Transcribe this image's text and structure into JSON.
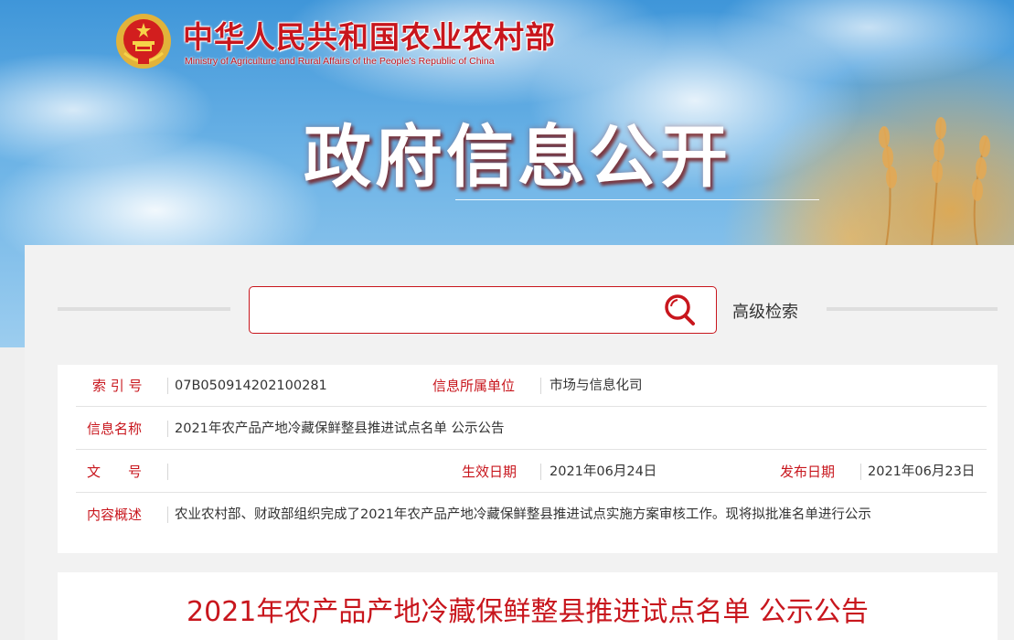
{
  "header": {
    "site_name_cn": "中华人民共和国农业农村部",
    "site_name_en": "Ministry of Agriculture and Rural Affairs of the People's Republic of China",
    "hero_title": "政府信息公开",
    "brand_color": "#c8161d"
  },
  "search": {
    "value": "",
    "placeholder": "",
    "search_icon": "search-icon",
    "advanced_label": "高级检索"
  },
  "info": {
    "index_label": "索 引 号",
    "index_value": "07B050914202100281",
    "unit_label": "信息所属单位",
    "unit_value": "市场与信息化司",
    "name_label": "信息名称",
    "name_value": "2021年农产品产地冷藏保鲜整县推进试点名单 公示公告",
    "doc_label": "文　　号",
    "doc_value": "",
    "effective_label": "生效日期",
    "effective_value": "2021年06月24日",
    "publish_label": "发布日期",
    "publish_value": "2021年06月23日",
    "summary_label": "内容概述",
    "summary_value": "农业农村部、财政部组织完成了2021年农产品产地冷藏保鲜整县推进试点实施方案审核工作。现将拟批准名单进行公示"
  },
  "article": {
    "title": "2021年农产品产地冷藏保鲜整县推进试点名单 公示公告"
  }
}
